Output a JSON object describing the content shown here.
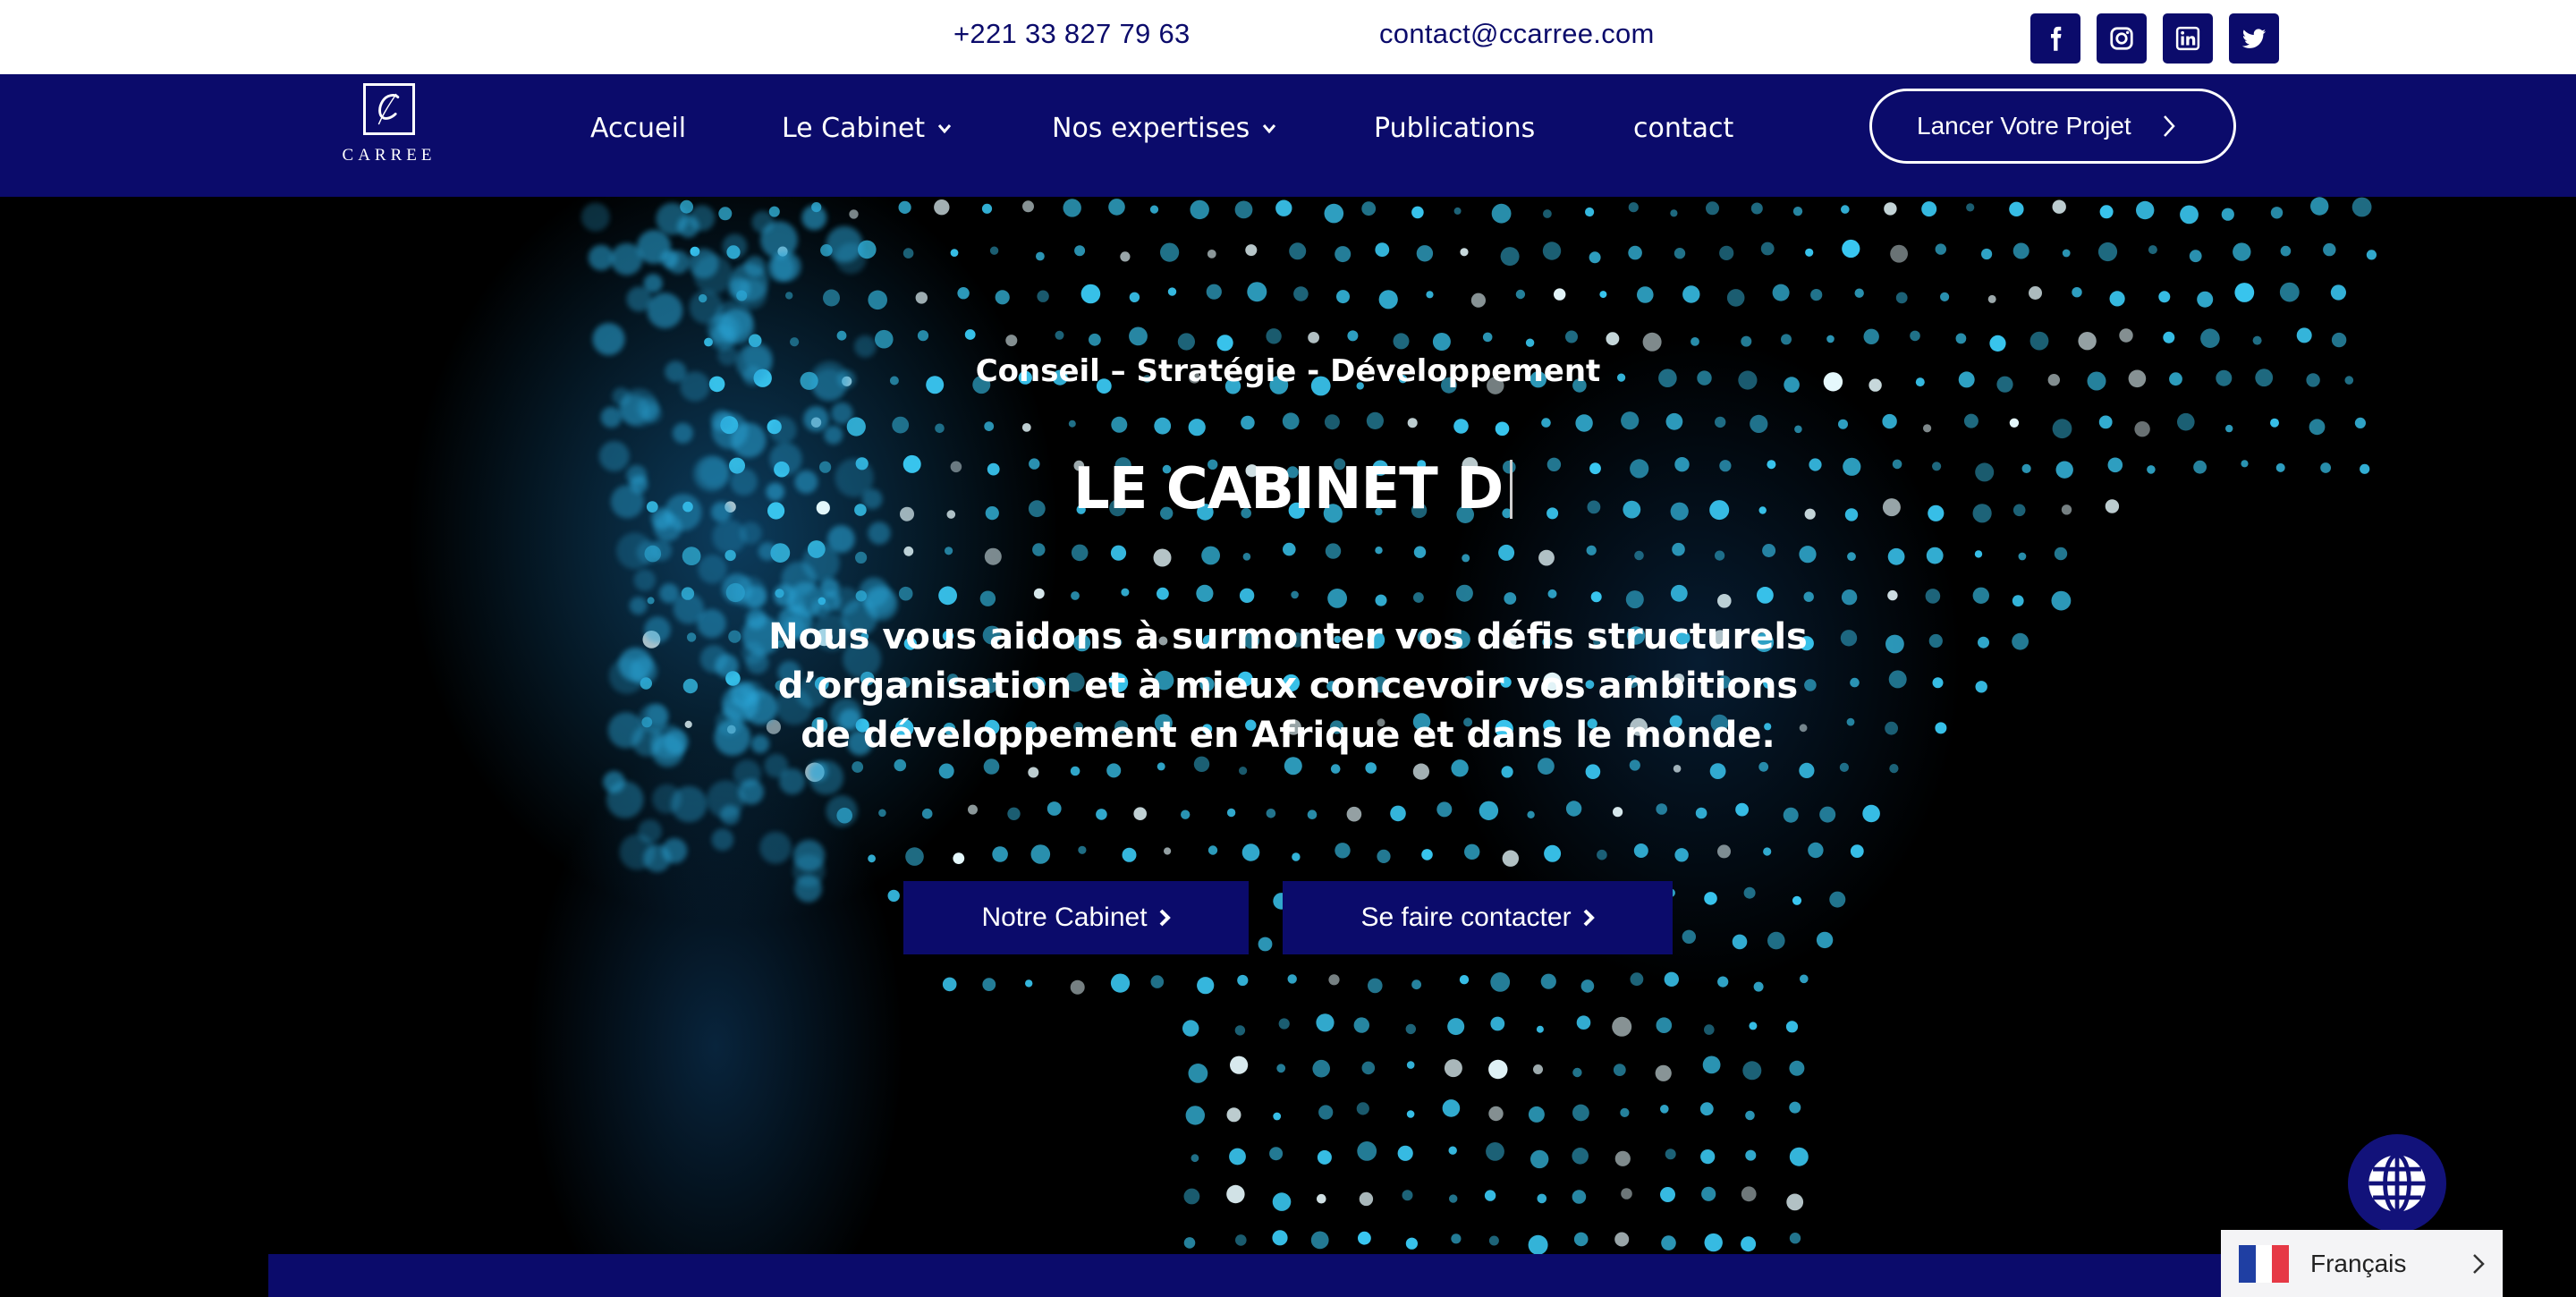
{
  "topbar": {
    "phone": "+221 33 827 79 63",
    "email": "contact@ccarree.com",
    "social": [
      {
        "icon": "facebook-icon"
      },
      {
        "icon": "instagram-icon"
      },
      {
        "icon": "linkedin-icon"
      },
      {
        "icon": "twitter-icon"
      }
    ]
  },
  "nav": {
    "logo_text": "CARREE",
    "logo_letter": "C",
    "items": [
      {
        "label": "Accueil",
        "dropdown": false
      },
      {
        "label": "Le Cabinet",
        "dropdown": true
      },
      {
        "label": "Nos expertises",
        "dropdown": true
      },
      {
        "label": "Publications",
        "dropdown": false
      },
      {
        "label": "contact",
        "dropdown": false
      }
    ],
    "cta_label": "Lancer Votre Projet"
  },
  "hero": {
    "subtitle": "Conseil – Stratégie - Développement",
    "headline": "LE CABINET D",
    "lead": "Nous vous aidons à surmonter vos défis structurels d’organisation et à mieux concevoir vos ambitions de développement en Afrique et dans le monde.",
    "buttons": [
      {
        "label": "Notre Cabinet"
      },
      {
        "label": "Se faire contacter"
      }
    ]
  },
  "language": {
    "current": "Français",
    "icon": "globe-icon"
  },
  "colors": {
    "brand": "#0b0b6b",
    "white": "#ffffff",
    "dot_cyan": "#39c6f0"
  }
}
